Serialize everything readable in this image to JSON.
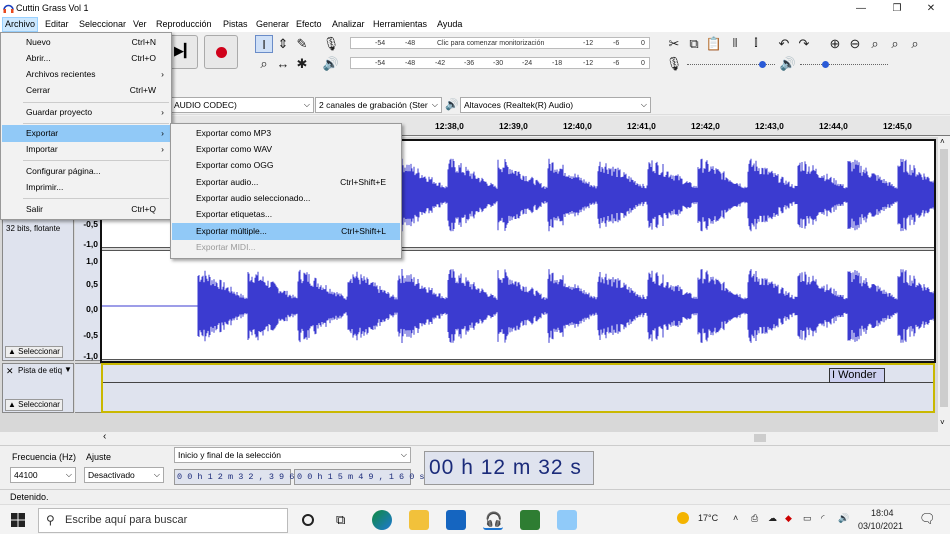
{
  "window": {
    "title": "Cuttin Grass Vol 1",
    "controls": [
      "—",
      "❐",
      "✕"
    ]
  },
  "menubar": [
    "Archivo",
    "Editar",
    "Seleccionar",
    "Ver",
    "Reproducción",
    "Pistas",
    "Generar",
    "Efecto",
    "Analizar",
    "Herramientas",
    "Ayuda"
  ],
  "meters": {
    "record": [
      "-54",
      "-48",
      "Clic para comenzar monitorización",
      "-12",
      "-6",
      "0"
    ],
    "playback": [
      "-54",
      "-48",
      "-42",
      "-36",
      "-30",
      "-24",
      "-18",
      "-12",
      "-6",
      "0"
    ]
  },
  "devices": {
    "host": "AUDIO CODEC)",
    "channels": "2 canales de grabación (Ster",
    "output": "Altavoces (Realtek(R) Audio)"
  },
  "ruler": [
    "12:38,0",
    "12:39,0",
    "12:40,0",
    "12:41,0",
    "12:42,0",
    "12:43,0",
    "12:44,0",
    "12:45,0"
  ],
  "track": {
    "info": "32 bits, flotante",
    "scale_top": [
      "-0,5",
      "-1,0"
    ],
    "scale_bottom": [
      "1,0",
      "0,5",
      "0,0",
      "-0,5",
      "-1,0"
    ],
    "select_label": "Seleccionar",
    "label_track_name": "Pista de etiq",
    "label_text": "I Wonder"
  },
  "selection": {
    "rate_label": "Frecuencia (Hz)",
    "rate_value": "44100",
    "snap_label": "Ajuste",
    "snap_value": "Desactivado",
    "mode": "Inicio y final de la selección",
    "start": "0 0 h 1 2 m 3 2 , 3 9 6 s",
    "end": "0 0 h 1 5 m 4 9 , 1 6 0 s",
    "position": "00 h 12 m 32 s"
  },
  "status": "Detenido.",
  "file_menu": [
    {
      "label": "Nuevo",
      "shortcut": "Ctrl+N"
    },
    {
      "label": "Abrir...",
      "shortcut": "Ctrl+O"
    },
    {
      "label": "Archivos recientes",
      "arrow": "›"
    },
    {
      "label": "Cerrar",
      "shortcut": "Ctrl+W"
    },
    {
      "label": "Guardar proyecto",
      "arrow": "›"
    },
    {
      "label": "Exportar",
      "arrow": "›"
    },
    {
      "label": "Importar",
      "arrow": "›"
    },
    {
      "label": "Configurar página..."
    },
    {
      "label": "Imprimir..."
    },
    {
      "label": "Salir",
      "shortcut": "Ctrl+Q"
    }
  ],
  "export_menu": [
    {
      "label": "Exportar como MP3"
    },
    {
      "label": "Exportar como WAV"
    },
    {
      "label": "Exportar como OGG"
    },
    {
      "label": "Exportar audio...",
      "shortcut": "Ctrl+Shift+E"
    },
    {
      "label": "Exportar audio seleccionado..."
    },
    {
      "label": "Exportar etiquetas..."
    },
    {
      "label": "Exportar múltiple...",
      "shortcut": "Ctrl+Shift+L"
    },
    {
      "label": "Exportar MIDI..."
    }
  ],
  "taskbar": {
    "search": "Escribe aquí para buscar",
    "weather": "17°C",
    "time": "18:04",
    "date": "03/10/2021"
  },
  "colors": {
    "waveform": "#3b3bd0",
    "highlight": "#91c9f7",
    "label_border": "#c9b800"
  }
}
